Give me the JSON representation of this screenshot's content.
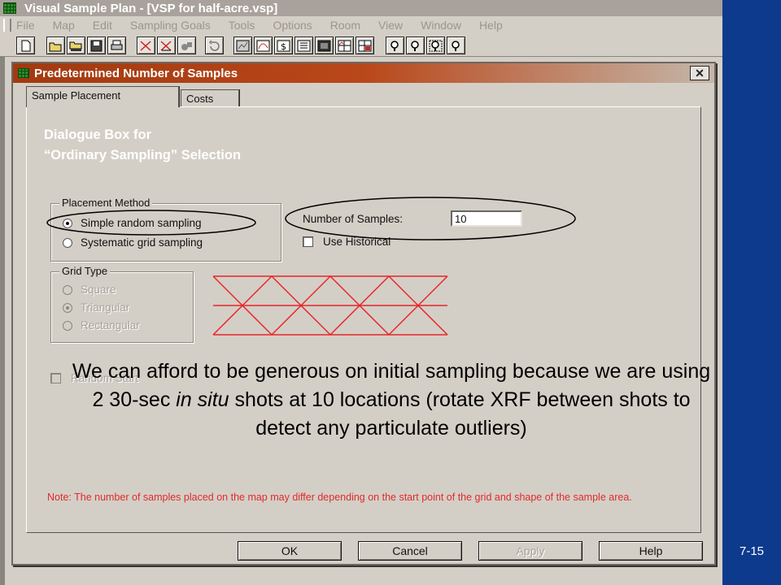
{
  "app": {
    "title": "Visual Sample Plan - [VSP for half-acre.vsp]",
    "menu": [
      "File",
      "Map",
      "Edit",
      "Sampling Goals",
      "Tools",
      "Options",
      "Room",
      "View",
      "Window",
      "Help"
    ],
    "toolbar_icons": [
      "new-file-icon",
      "open-folder-icon",
      "open-map-icon",
      "save-icon",
      "print-icon",
      "add-sample-icon",
      "remove-sample-icon",
      "sample-tool-icon",
      "undo-icon",
      "map-view-icon",
      "graph-view-icon",
      "cost-view-icon",
      "report-view-icon",
      "coordinates-view-icon",
      "multi-view-icon",
      "tile-view-icon",
      "zoom-in-icon",
      "zoom-out-icon",
      "zoom-window-icon",
      "zoom-extents-icon"
    ]
  },
  "dialog": {
    "title": "Predetermined Number of Samples",
    "close_label": "✕",
    "tabs": [
      {
        "label": "Sample Placement",
        "active": true
      },
      {
        "label": "Costs",
        "active": false
      }
    ],
    "annotation": {
      "line1": "Dialogue Box for",
      "line2": "“Ordinary Sampling” Selection"
    },
    "placement_method": {
      "label": "Placement Method",
      "options": [
        {
          "label": "Simple random sampling",
          "selected": true
        },
        {
          "label": "Systematic grid sampling",
          "selected": false
        }
      ]
    },
    "number_of_samples": {
      "label": "Number of Samples:",
      "value": "10"
    },
    "use_historical": {
      "label": "Use Historical",
      "checked": false
    },
    "grid_type": {
      "label": "Grid Type",
      "options": [
        {
          "label": "Square",
          "selected": false
        },
        {
          "label": "Triangular",
          "selected": true
        },
        {
          "label": "Rectangular",
          "selected": false
        }
      ]
    },
    "random_start": {
      "label": "Random Start",
      "checked": false
    },
    "overlay_text": "We can afford to be generous on initial sampling because we are using 2 30-sec in situ shots at 10 locations (rotate XRF between shots to detect any particulate outliers)",
    "overlay_text_parts": {
      "before": "We can afford to be generous on initial sampling because we are using 2 30-sec ",
      "italic": "in situ",
      "after": " shots at 10 locations (rotate XRF between shots to detect any particulate outliers)"
    },
    "note": "Note:  The number of samples placed on the map may differ depending on the start point of the grid and shape of the sample area.",
    "buttons": [
      {
        "label": "OK",
        "enabled": true
      },
      {
        "label": "Cancel",
        "enabled": true
      },
      {
        "label": "Apply",
        "enabled": false
      },
      {
        "label": "Help",
        "enabled": true
      }
    ]
  },
  "slide_number": "7-15",
  "colors": {
    "blue_band": "#0d3a8c",
    "dialog_title": "#a23a10",
    "note_red": "#e02b2b",
    "grid_red": "#e8262b",
    "annotation_white": "#ffffff"
  }
}
